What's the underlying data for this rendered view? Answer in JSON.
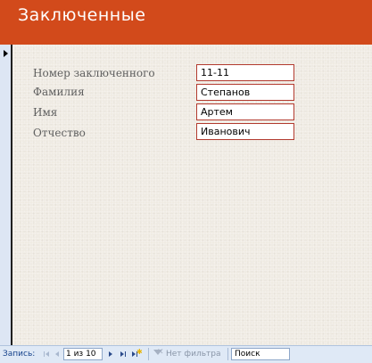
{
  "form": {
    "title": "Заключенные"
  },
  "fields": [
    {
      "label": "Номер заключенного",
      "value": "11-11"
    },
    {
      "label": "Фамилия",
      "value": "Степанов"
    },
    {
      "label": "Имя",
      "value": "Артем"
    },
    {
      "label": "Отчество",
      "value": "Иванович"
    }
  ],
  "navigation": {
    "record_label": "Запись:",
    "current_record": "1 из 10",
    "filter_status": "Нет фильтра",
    "search_placeholder": "Поиск",
    "buttons": {
      "first": "first-record-icon",
      "previous": "previous-record-icon",
      "next": "next-record-icon",
      "last": "last-record-icon",
      "new": "new-record-icon"
    }
  },
  "colors": {
    "header_background": "#d24a1b",
    "field_border": "#b23a2e",
    "detail_background": "#efebe3",
    "navbar_background": "#dfe9f6"
  }
}
